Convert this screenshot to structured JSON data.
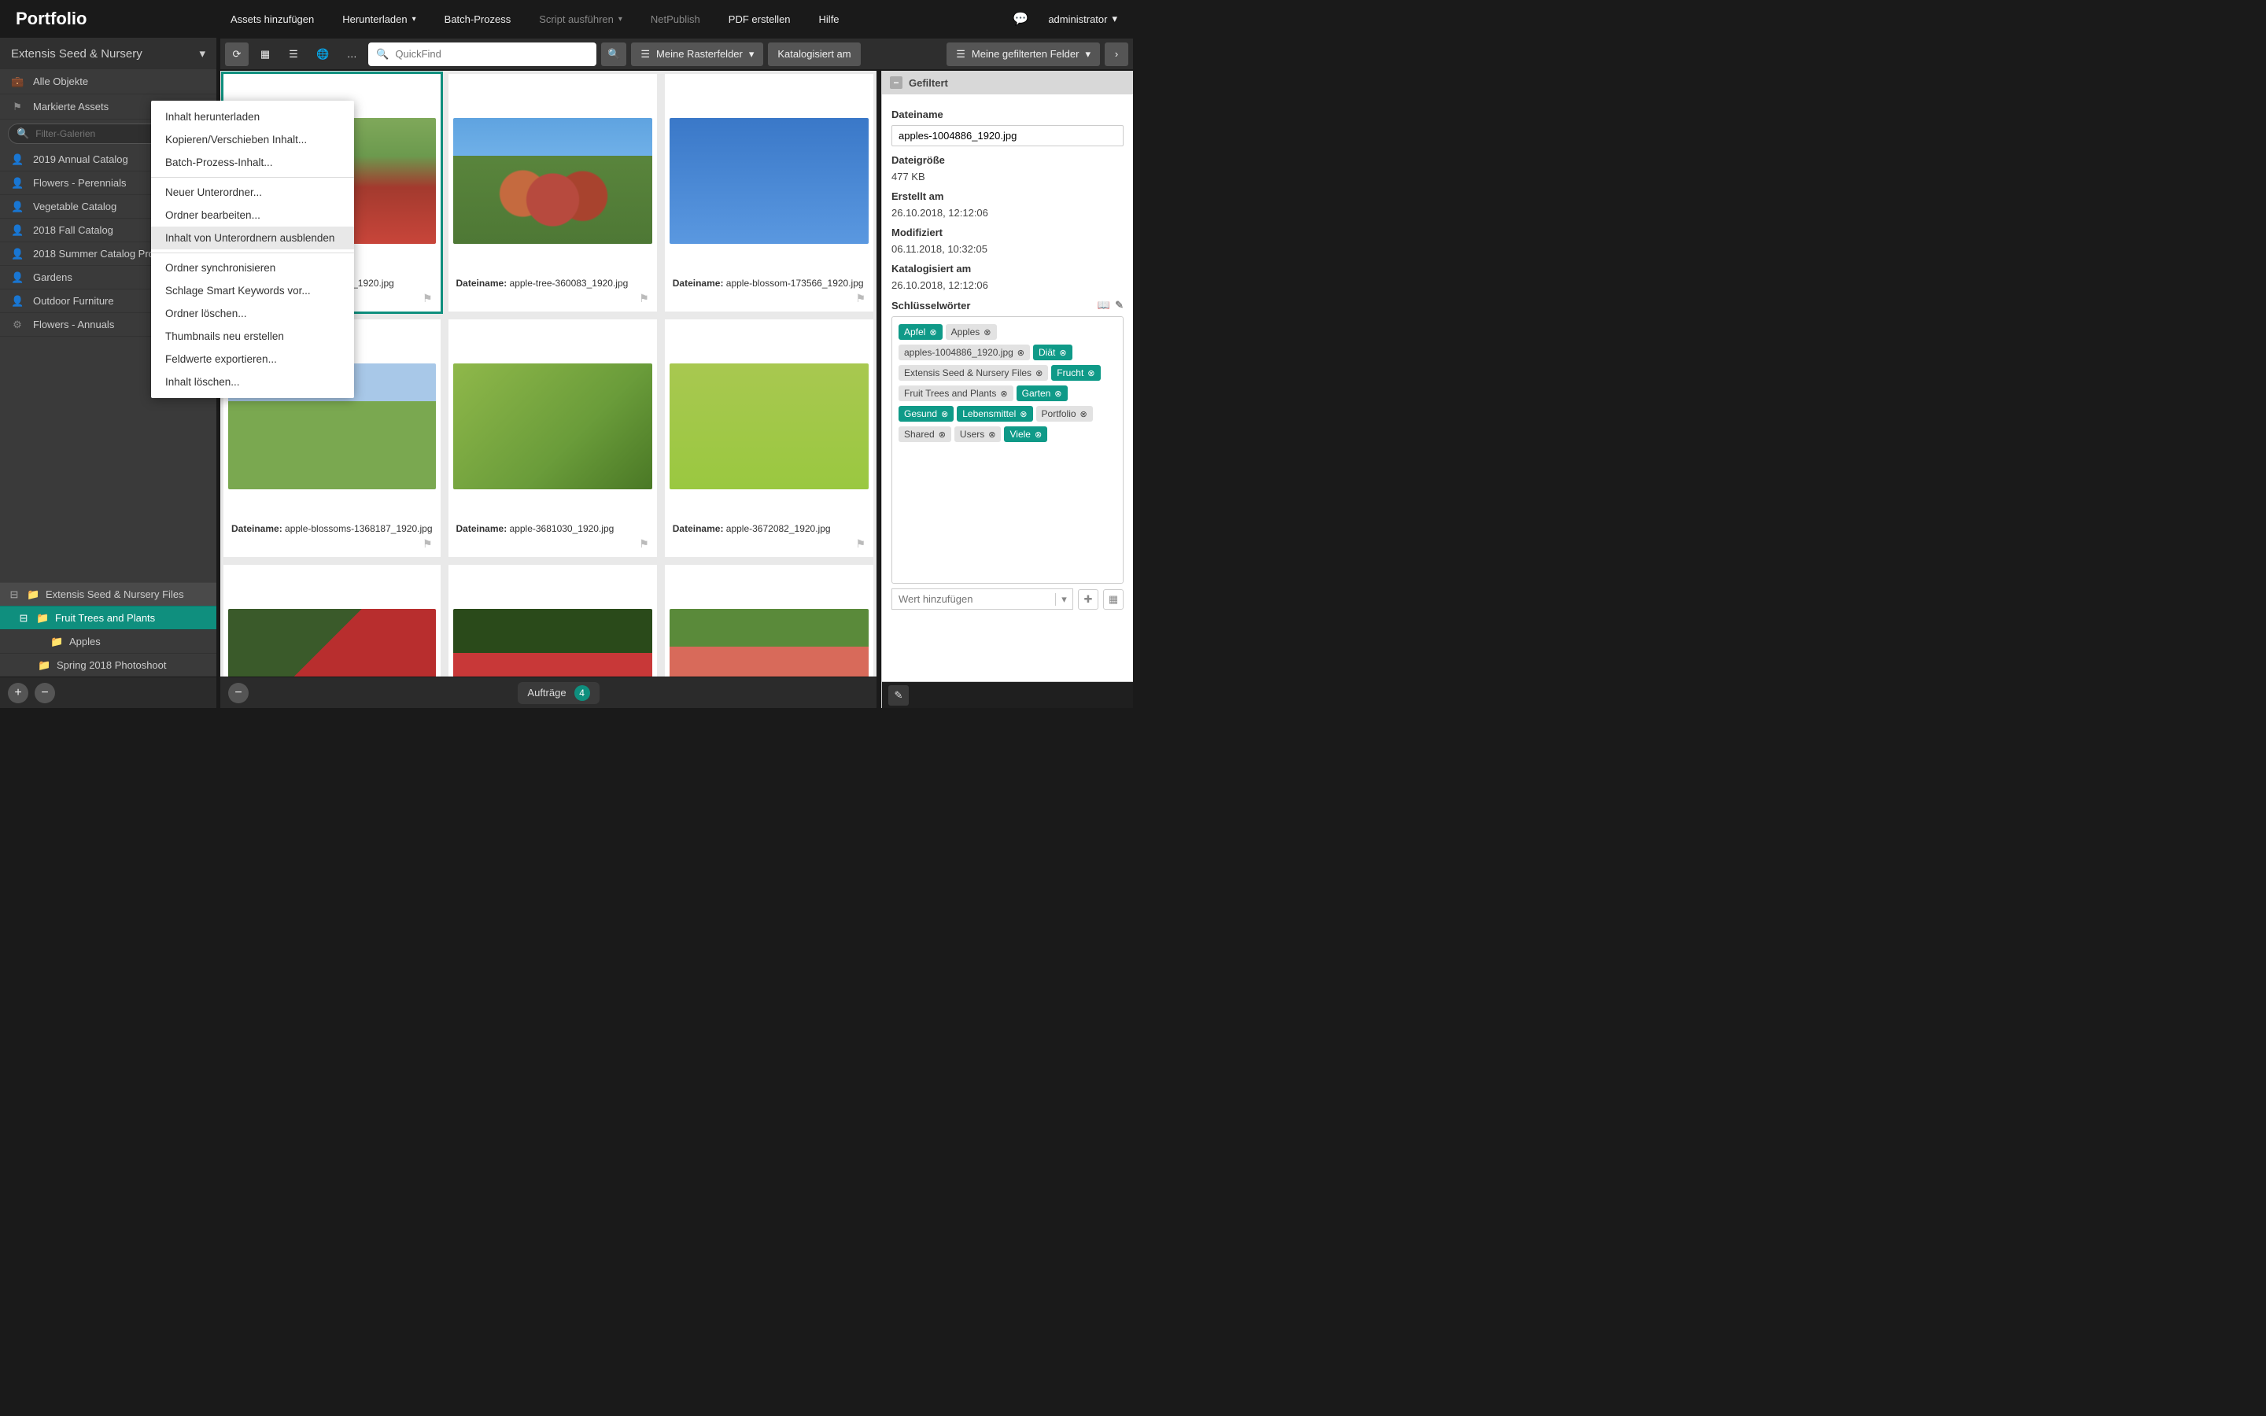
{
  "app": {
    "name": "Portfolio"
  },
  "topmenu": {
    "add_assets": "Assets hinzufügen",
    "download": "Herunterladen",
    "batch": "Batch-Prozess",
    "script": "Script ausführen",
    "netpublish": "NetPublish",
    "pdf": "PDF erstellen",
    "help": "Hilfe",
    "user": "administrator"
  },
  "toolbar": {
    "quickfind_placeholder": "QuickFind",
    "grid_fields": "Meine Rasterfelder",
    "sort_field": "Katalogisiert am",
    "filtered_fields": "Meine gefilterten Felder"
  },
  "sidebar": {
    "catalog": "Extensis Seed & Nursery",
    "all": "Alle Objekte",
    "flagged": "Markierte Assets",
    "filter_placeholder": "Filter-Galerien",
    "galleries": [
      "2019 Annual Catalog",
      "Flowers - Perennials",
      "Vegetable Catalog",
      "2018 Fall Catalog",
      "2018 Summer Catalog Products",
      "Gardens",
      "Outdoor Furniture",
      "Flowers - Annuals"
    ],
    "tree": {
      "root": "Extensis Seed & Nursery Files",
      "folder1": "Fruit Trees and Plants",
      "folder1a": "Apples",
      "folder2": "Spring 2018 Photoshoot"
    }
  },
  "grid": {
    "field_label": "Dateiname:",
    "items": [
      {
        "filename": "apples-1004886_1920.jpg",
        "imgcls": "img-apples1",
        "selected": true
      },
      {
        "filename": "apple-tree-360083_1920.jpg",
        "imgcls": "img-apples2"
      },
      {
        "filename": "apple-blossom-173566_1920.jpg",
        "imgcls": "img-blossom"
      },
      {
        "filename": "apple-blossoms-1368187_1920.jpg",
        "imgcls": "img-branch"
      },
      {
        "filename": "apple-3681030_1920.jpg",
        "imgcls": "img-green"
      },
      {
        "filename": "apple-3672082_1920.jpg",
        "imgcls": "img-green2"
      },
      {
        "filename": "",
        "imgcls": "img-red"
      },
      {
        "filename": "",
        "imgcls": "img-red2"
      },
      {
        "filename": "",
        "imgcls": "img-pink"
      }
    ]
  },
  "bottombar": {
    "jobs_label": "Aufträge",
    "jobs_count": "4"
  },
  "context_menu": {
    "items": [
      "Inhalt herunterladen",
      "Kopieren/Verschieben Inhalt...",
      "Batch-Prozess-Inhalt...",
      "---",
      "Neuer Unterordner...",
      "Ordner bearbeiten...",
      "Inhalt von Unterordnern ausblenden",
      "---",
      "Ordner synchronisieren",
      "Schlage Smart Keywords vor...",
      "Ordner löschen...",
      "Thumbnails neu erstellen",
      "Feldwerte exportieren...",
      "Inhalt löschen..."
    ],
    "hover_index": 6
  },
  "rightpanel": {
    "title": "Gefiltert",
    "fields": {
      "filename_label": "Dateiname",
      "filename_value": "apples-1004886_1920.jpg",
      "filesize_label": "Dateigröße",
      "filesize_value": "477 KB",
      "created_label": "Erstellt am",
      "created_value": "26.10.2018, 12:12:06",
      "modified_label": "Modifiziert",
      "modified_value": "06.11.2018, 10:32:05",
      "cataloged_label": "Katalogisiert am",
      "cataloged_value": "26.10.2018, 12:12:06",
      "keywords_label": "Schlüsselwörter"
    },
    "keywords": [
      {
        "text": "Apfel",
        "teal": true
      },
      {
        "text": "Apples",
        "teal": false
      },
      {
        "text": "apples-1004886_1920.jpg",
        "teal": false
      },
      {
        "text": "Diät",
        "teal": true
      },
      {
        "text": "Extensis Seed & Nursery Files",
        "teal": false
      },
      {
        "text": "Frucht",
        "teal": true
      },
      {
        "text": "Fruit Trees and Plants",
        "teal": false
      },
      {
        "text": "Garten",
        "teal": true
      },
      {
        "text": "Gesund",
        "teal": true
      },
      {
        "text": "Lebensmittel",
        "teal": true
      },
      {
        "text": "Portfolio",
        "teal": false
      },
      {
        "text": "Shared",
        "teal": false
      },
      {
        "text": "Users",
        "teal": false
      },
      {
        "text": "Viele",
        "teal": true
      }
    ],
    "add_placeholder": "Wert hinzufügen"
  }
}
